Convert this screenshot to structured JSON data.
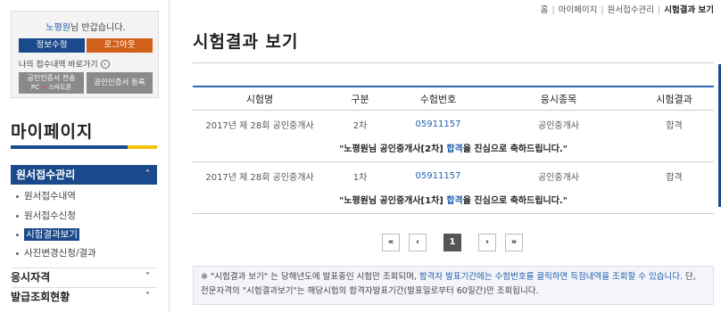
{
  "sidebar": {
    "welcome_name": "노평원",
    "welcome_suffix": "님 반갑습니다.",
    "edit_info": "정보수정",
    "logout": "로그아웃",
    "shortcut": "나의 접수내역 바로가기",
    "cert_send": "공인인증서 전송",
    "cert_send_pc": "PC",
    "cert_send_phone": "스마트폰",
    "cert_register": "공인인증서 등록",
    "title": "마이페이지",
    "active_menu": "원서접수관리",
    "submenu": [
      "원서접수내역",
      "원서접수신청",
      "시험결과보기",
      "사진변경신청/결과"
    ],
    "menu_items": [
      "응시자격",
      "발급조회현황"
    ]
  },
  "breadcrumb": [
    "홈",
    "마이페이지",
    "원서접수관리",
    "시험결과 보기"
  ],
  "page_title": "시험결과 보기",
  "table": {
    "headers": [
      "시험명",
      "구분",
      "수험번호",
      "응시종목",
      "시험결과"
    ],
    "rows": [
      {
        "exam": "2017년 제 28회 공인중개사",
        "round": "2차",
        "number": "05911157",
        "subject": "공인중개사",
        "result": "합격",
        "msg_pre": "\"노평원님 공인중개사[2차] ",
        "msg_pass": "합격",
        "msg_post": "을 진심으로 축하드립니다.\""
      },
      {
        "exam": "2017년 제 28회 공인중개사",
        "round": "1차",
        "number": "05911157",
        "subject": "공인중개사",
        "result": "합격",
        "msg_pre": "\"노평원님 공인중개사[1차] ",
        "msg_pass": "합격",
        "msg_post": "을 진심으로 축하드립니다.\""
      }
    ]
  },
  "pagination": {
    "first": "«",
    "prev": "‹",
    "current": "1",
    "next": "›",
    "last": "»"
  },
  "notice": {
    "part1": "※ \"시험결과 보기\" 는 당해년도에 발표중인 시험만 조회되며, ",
    "part2": "합격자 발표기간에는 수험번호를 클릭하면 득점내역을 조회할 수 있습니다.",
    "part3": " 단, 전문자격의 \"시험결과보기\"는 해당시험의 합격자발표기간(발표일로부터 60일간)만 조회됩니다."
  },
  "colors": {
    "primary": "#1b4a8c",
    "accent": "#d0601c",
    "link": "#2060b0",
    "yellow": "#f2c200"
  }
}
